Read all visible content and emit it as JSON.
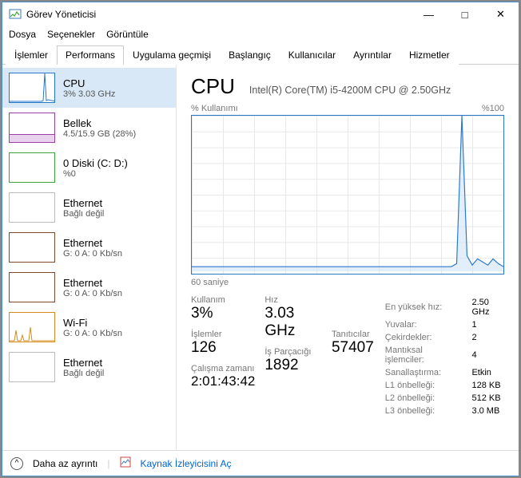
{
  "window": {
    "title": "Görev Yöneticisi"
  },
  "menu": {
    "file": "Dosya",
    "options": "Seçenekler",
    "view": "Görüntüle"
  },
  "tabs": {
    "processes": "İşlemler",
    "performance": "Performans",
    "apphistory": "Uygulama geçmişi",
    "startup": "Başlangıç",
    "users": "Kullanıcılar",
    "details": "Ayrıntılar",
    "services": "Hizmetler"
  },
  "sidebar": {
    "cpu": {
      "name": "CPU",
      "sub": "3% 3.03 GHz"
    },
    "mem": {
      "name": "Bellek",
      "sub": "4.5/15.9 GB (28%)"
    },
    "disk": {
      "name": "0 Diski (C: D:)",
      "sub": "%0"
    },
    "eth0": {
      "name": "Ethernet",
      "sub": "Bağlı değil"
    },
    "eth1": {
      "name": "Ethernet",
      "sub": "G: 0 A: 0 Kb/sn"
    },
    "eth2": {
      "name": "Ethernet",
      "sub": "G: 0 A: 0 Kb/sn"
    },
    "wifi": {
      "name": "Wi-Fi",
      "sub": "G: 0 A: 0 Kb/sn"
    },
    "eth3": {
      "name": "Ethernet",
      "sub": "Bağlı değil"
    }
  },
  "panel": {
    "title": "CPU",
    "subtitle": "Intel(R) Core(TM) i5-4200M CPU @ 2.50GHz",
    "ylabel": "% Kullanımı",
    "ymax": "%100",
    "xlabel": "60 saniye",
    "stats": {
      "kullanim_label": "Kullanım",
      "kullanim": "3%",
      "hiz_label": "Hız",
      "hiz": "3.03 GHz",
      "islemler_label": "İşlemler",
      "islemler": "126",
      "isparcacigi_label": "İş Parçacığı",
      "isparcacigi": "1892",
      "tanitici_label": "Tanıtıcılar",
      "tanitici": "57407",
      "calisma_label": "Çalışma zamanı",
      "calisma": "2:01:43:42"
    },
    "right": {
      "maxspeed_label": "En yüksek hız:",
      "maxspeed": "2.50 GHz",
      "sockets_label": "Yuvalar:",
      "sockets": "1",
      "cores_label": "Çekirdekler:",
      "cores": "2",
      "logical_label": "Mantıksal işlemciler:",
      "logical": "4",
      "virt_label": "Sanallaştırma:",
      "virt": "Etkin",
      "l1_label": "L1 önbelleği:",
      "l1": "128 KB",
      "l2_label": "L2 önbelleği:",
      "l2": "512 KB",
      "l3_label": "L3 önbelleği:",
      "l3": "3.0 MB"
    }
  },
  "footer": {
    "fewer": "Daha az ayrıntı",
    "resmon": "Kaynak İzleyicisini Aç"
  },
  "chart_data": {
    "type": "line",
    "xlabel": "60 saniye",
    "ylabel": "% Kullanımı",
    "ylim": [
      0,
      100
    ],
    "x_seconds_ago": [
      60,
      58,
      56,
      54,
      52,
      50,
      48,
      46,
      44,
      42,
      40,
      38,
      36,
      34,
      32,
      30,
      28,
      26,
      24,
      22,
      20,
      18,
      16,
      14,
      12,
      10,
      9,
      8,
      7,
      6,
      5,
      4,
      3,
      2,
      1,
      0
    ],
    "values": [
      3,
      3,
      3,
      3,
      3,
      3,
      3,
      3,
      3,
      3,
      3,
      3,
      3,
      3,
      3,
      3,
      3,
      3,
      3,
      3,
      3,
      3,
      3,
      3,
      3,
      3,
      5,
      100,
      10,
      4,
      8,
      6,
      4,
      8,
      5,
      3
    ]
  }
}
